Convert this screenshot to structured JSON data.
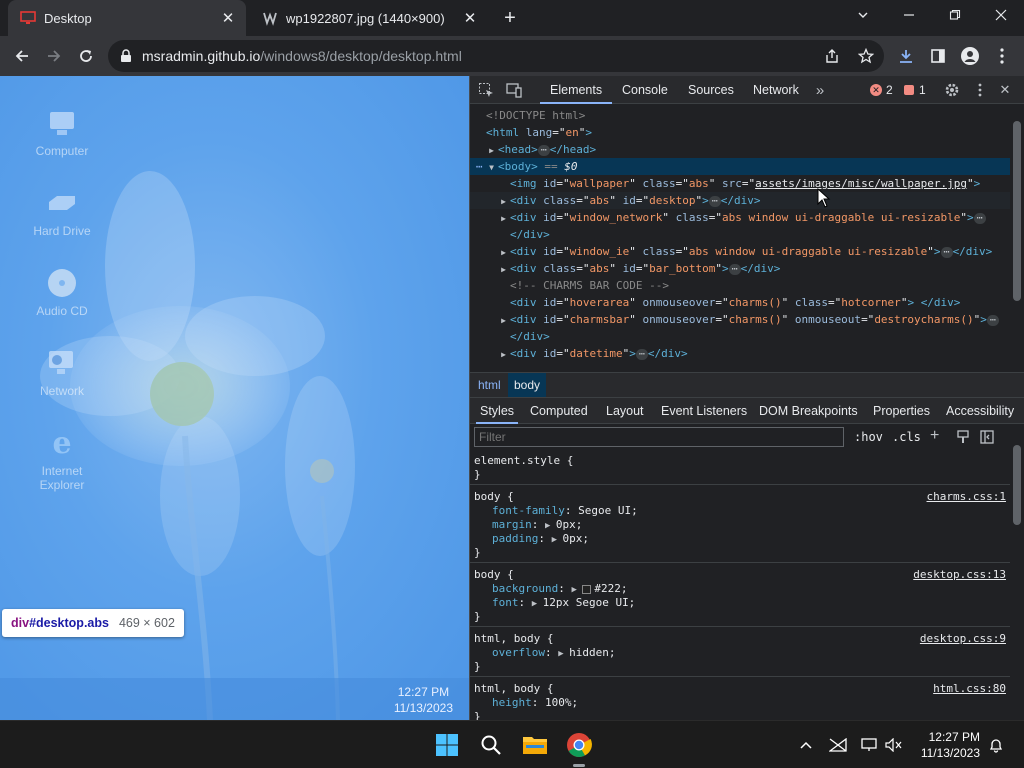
{
  "browser": {
    "tabs": [
      {
        "title": "Desktop",
        "active": true
      },
      {
        "title": "wp1922807.jpg (1440×900)",
        "active": false
      }
    ],
    "url_host": "msradmin.github.io",
    "url_path": "/windows8/desktop/desktop.html"
  },
  "page": {
    "desktop_icons": [
      {
        "label": "Computer",
        "icon": "computer-icon"
      },
      {
        "label": "Hard Drive",
        "icon": "hard-drive-icon"
      },
      {
        "label": "Audio CD",
        "icon": "cd-icon"
      },
      {
        "label": "Network",
        "icon": "network-icon"
      },
      {
        "label": "Internet Explorer",
        "icon": "ie-icon"
      }
    ],
    "clock_time": "12:27 PM",
    "clock_date": "11/13/2023",
    "tooltip_selector_tag": "div",
    "tooltip_selector_id": "#desktop.abs",
    "tooltip_size": "469 × 602"
  },
  "devtools": {
    "tabs": [
      "Elements",
      "Console",
      "Sources",
      "Network"
    ],
    "active_tab": "Elements",
    "errors": "2",
    "issues": "1",
    "dom_lines": [
      {
        "indent": 1,
        "html": "<span class='comment'>&lt;!DOCTYPE html&gt;</span>"
      },
      {
        "indent": 1,
        "html": "<span class='tag'>&lt;html</span> <span class='attr'>lang</span>=\"<span class='aval'>en</span>\"<span class='tag'>&gt;</span>"
      },
      {
        "indent": 2,
        "caret": "▶",
        "html": "<span class='tag'>&lt;head&gt;</span><span class='ell'>⋯</span><span class='tag'>&lt;/head&gt;</span>"
      },
      {
        "indent": 2,
        "caret": "▼",
        "selected": true,
        "prefix": "⋯ ",
        "html": "<span class='tag'>&lt;body&gt;</span> <span class='comment'>==</span> <span class='txt'><i>$0</i></span>"
      },
      {
        "indent": 3,
        "html": "<span class='tag'>&lt;img</span> <span class='attr'>id</span>=\"<span class='aval'>wallpaper</span>\" <span class='attr'>class</span>=\"<span class='aval'>abs</span>\" <span class='attr'>src</span>=\"<span class='txt' style='text-decoration:underline'>assets/images/misc/wallpaper.jpg</span>\"<span class='tag'>&gt;</span>"
      },
      {
        "indent": 3,
        "caret": "▶",
        "hover": true,
        "html": "<span class='tag'>&lt;div</span> <span class='attr'>class</span>=\"<span class='aval'>abs</span>\" <span class='attr'>id</span>=\"<span class='aval'>desktop</span>\"<span class='tag'>&gt;</span><span class='ell'>⋯</span><span class='tag'>&lt;/div&gt;</span>"
      },
      {
        "indent": 3,
        "caret": "▶",
        "html": "<span class='tag'>&lt;div</span> <span class='attr'>id</span>=\"<span class='aval'>window_network</span>\" <span class='attr'>class</span>=\"<span class='aval'>abs window ui-draggable ui-resizable</span>\"<span class='tag'>&gt;</span><span class='ell'>⋯</span>"
      },
      {
        "indent": 3,
        "html": "<span class='tag'>&lt;/div&gt;</span>"
      },
      {
        "indent": 3,
        "caret": "▶",
        "html": "<span class='tag'>&lt;div</span> <span class='attr'>id</span>=\"<span class='aval'>window_ie</span>\" <span class='attr'>class</span>=\"<span class='aval'>abs window ui-draggable ui-resizable</span>\"<span class='tag'>&gt;</span><span class='ell'>⋯</span><span class='tag'>&lt;/div&gt;</span>"
      },
      {
        "indent": 3,
        "caret": "▶",
        "html": "<span class='tag'>&lt;div</span> <span class='attr'>class</span>=\"<span class='aval'>abs</span>\" <span class='attr'>id</span>=\"<span class='aval'>bar_bottom</span>\"<span class='tag'>&gt;</span><span class='ell'>⋯</span><span class='tag'>&lt;/div&gt;</span>"
      },
      {
        "indent": 3,
        "html": "<span class='comment'>&lt;!-- CHARMS BAR CODE --&gt;</span>"
      },
      {
        "indent": 3,
        "html": "<span class='tag'>&lt;div</span> <span class='attr'>id</span>=\"<span class='aval'>hoverarea</span>\" <span class='attr'>onmouseover</span>=\"<span class='aval'>charms()</span>\" <span class='attr'>class</span>=\"<span class='aval'>hotcorner</span>\"<span class='tag'>&gt;</span> <span class='tag'>&lt;/div&gt;</span>"
      },
      {
        "indent": 3,
        "caret": "▶",
        "html": "<span class='tag'>&lt;div</span> <span class='attr'>id</span>=\"<span class='aval'>charmsbar</span>\" <span class='attr'>onmouseover</span>=\"<span class='aval'>charms()</span>\" <span class='attr'>onmouseout</span>=\"<span class='aval'>destroycharms()</span>\"<span class='tag'>&gt;</span><span class='ell'>⋯</span>"
      },
      {
        "indent": 3,
        "html": "<span class='tag'>&lt;/div&gt;</span>"
      },
      {
        "indent": 3,
        "caret": "▶",
        "html": "<span class='tag'>&lt;div</span> <span class='attr'>id</span>=\"<span class='aval'>datetime</span>\"<span class='tag'>&gt;</span><span class='ell'>⋯</span><span class='tag'>&lt;/div&gt;</span>"
      }
    ],
    "breadcrumbs": [
      "html",
      "body"
    ],
    "sub_tabs": [
      "Styles",
      "Computed",
      "Layout",
      "Event Listeners",
      "DOM Breakpoints",
      "Properties",
      "Accessibility"
    ],
    "filter_placeholder": "Filter",
    "hov_label": ":hov",
    "cls_label": ".cls",
    "style_rules": [
      {
        "selector": "element.style {",
        "source": "",
        "props": []
      },
      {
        "selector": "body {",
        "source": "charms.css:1",
        "props": [
          {
            "name": "font-family",
            "value": "Segoe UI;"
          },
          {
            "name": "margin",
            "value": "0px;",
            "arrow": true
          },
          {
            "name": "padding",
            "value": "0px;",
            "arrow": true
          }
        ]
      },
      {
        "selector": "body {",
        "source": "desktop.css:13",
        "props": [
          {
            "name": "background",
            "value": "#222;",
            "arrow": true,
            "swatch": "#222222"
          },
          {
            "name": "font",
            "value": "12px Segoe UI;",
            "arrow": true
          }
        ]
      },
      {
        "selector": "html, body {",
        "source": "desktop.css:9",
        "props": [
          {
            "name": "overflow",
            "value": "hidden;",
            "arrow": true
          }
        ]
      },
      {
        "selector": "html, body {",
        "source": "html.css:80",
        "props": [
          {
            "name": "height",
            "value": "100%;"
          }
        ]
      }
    ]
  },
  "taskbar": {
    "time": "12:27 PM",
    "date": "11/13/2023"
  }
}
